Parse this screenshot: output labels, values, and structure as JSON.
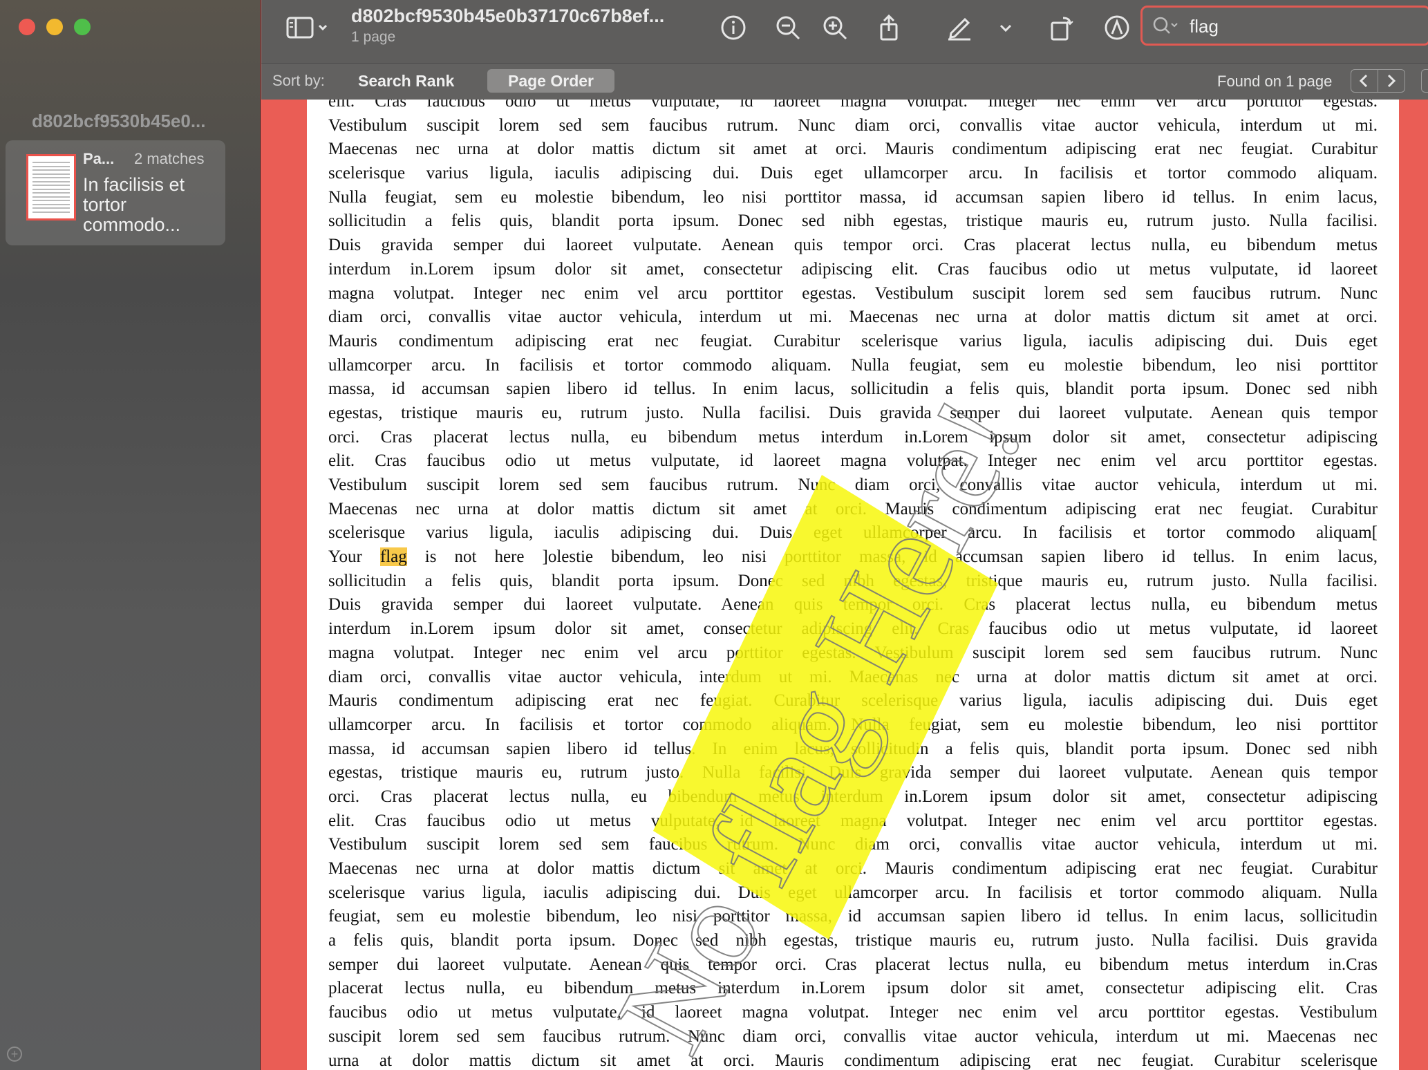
{
  "sidebar": {
    "title": "d802bcf9530b45e0...",
    "result": {
      "page_label": "Pa...",
      "matches": "2 matches",
      "snippet": "In facilisis et tortor commodo..."
    }
  },
  "toolbar": {
    "doc_title": "d802bcf9530b45e0b37170c67b8ef...",
    "doc_subtitle": "1 page",
    "search_value": "flag"
  },
  "sortbar": {
    "label": "Sort by:",
    "rank": "Search Rank",
    "order": "Page Order",
    "found": "Found on 1 page"
  },
  "document": {
    "lines": [
      "elit.  Cras faucibus odio ut metus vulputate, id laoreet magna volutpat.  Integer nec enim vel arcu porttitor egestas.",
      "Vestibulum suscipit lorem sed sem faucibus rutrum.  Nunc diam orci, convallis vitae auctor vehicula, interdum ut mi.",
      "Maecenas nec urna at dolor mattis dictum sit amet at orci.  Mauris condimentum adipiscing erat nec feugiat.  Curabitur",
      "scelerisque varius ligula, iaculis adipiscing dui.  Duis eget ullamcorper arcu.  In facilisis et tortor commodo aliquam.",
      "Nulla feugiat, sem eu molestie bibendum, leo nisi porttitor massa, id accumsan sapien libero id tellus.  In enim lacus,",
      "sollicitudin a felis quis, blandit porta ipsum.  Donec sed nibh egestas, tristique mauris eu, rutrum justo.  Nulla facilisi.",
      "Duis gravida semper dui laoreet vulputate.  Aenean quis tempor orci.  Cras placerat lectus nulla, eu bibendum metus",
      "interdum in.Lorem ipsum dolor sit amet, consectetur adipiscing elit.  Cras faucibus odio ut metus vulputate, id laoreet",
      "magna volutpat.  Integer nec enim vel arcu porttitor egestas.  Vestibulum suscipit lorem sed sem faucibus rutrum.  Nunc",
      "diam orci, convallis vitae auctor vehicula, interdum ut mi.  Maecenas nec urna at dolor mattis dictum sit amet at orci.",
      "Mauris condimentum adipiscing erat nec feugiat.  Curabitur scelerisque varius ligula, iaculis adipiscing dui.  Duis eget",
      "ullamcorper arcu.  In facilisis et tortor commodo aliquam.  Nulla feugiat, sem eu molestie bibendum, leo nisi porttitor",
      "massa, id accumsan sapien libero id tellus.  In enim lacus, sollicitudin a felis quis, blandit porta ipsum.  Donec sed nibh",
      "egestas, tristique mauris eu, rutrum justo.  Nulla facilisi.  Duis gravida semper dui laoreet vulputate.  Aenean quis tempor",
      "orci.  Cras placerat lectus nulla, eu bibendum metus interdum in.Lorem ipsum dolor sit amet, consectetur adipiscing",
      "elit.  Cras faucibus odio ut metus vulputate, id laoreet magna volutpat.  Integer nec enim vel arcu porttitor egestas.",
      "Vestibulum suscipit lorem sed sem faucibus rutrum.  Nunc diam orci, convallis vitae auctor vehicula, interdum ut mi.",
      "Maecenas nec urna at dolor mattis dictum sit amet at orci.  Mauris condimentum adipiscing erat nec feugiat.  Curabitur",
      "scelerisque varius ligula, iaculis adipiscing dui.  Duis eget ullamcorper arcu.  In facilisis et tortor commodo aliquam[",
      "Your |flag| is not here ]olestie bibendum, leo nisi porttitor massa, id accumsan sapien libero id tellus.  In enim lacus,",
      "sollicitudin a felis quis, blandit porta ipsum.  Donec sed nibh egestas, tristique mauris eu, rutrum justo.  Nulla facilisi.",
      "Duis gravida semper dui laoreet vulputate.  Aenean quis tempor orci.  Cras placerat lectus nulla, eu bibendum metus",
      "interdum in.Lorem ipsum dolor sit amet, consectetur adipiscing elit.  Cras faucibus odio ut metus vulputate, id laoreet",
      "magna volutpat.  Integer nec enim vel arcu porttitor egestas.  Vestibulum suscipit lorem sed sem faucibus rutrum.  Nunc",
      "diam orci, convallis vitae auctor vehicula, interdum ut mi.  Maecenas nec urna at dolor mattis dictum sit amet at orci.",
      "Mauris condimentum adipiscing erat nec feugiat.  Curabitur scelerisque varius ligula, iaculis adipiscing dui.  Duis eget",
      "ullamcorper arcu.  In facilisis et tortor commodo aliquam.  Nulla feugiat, sem eu molestie bibendum, leo nisi porttitor",
      "massa, id accumsan sapien libero id tellus.  In enim lacus, sollicitudin a felis quis, blandit porta ipsum.  Donec sed nibh",
      "egestas, tristique mauris eu, rutrum justo.  Nulla facilisi.  Duis gravida semper dui laoreet vulputate.  Aenean quis tempor",
      "orci.  Cras placerat lectus nulla, eu bibendum metus interdum in.Lorem ipsum dolor sit amet, consectetur adipiscing",
      "elit.  Cras faucibus odio ut metus vulputate, id laoreet magna volutpat.  Integer nec enim vel arcu porttitor egestas.",
      "Vestibulum suscipit lorem sed sem faucibus rutrum.  Nunc diam orci, convallis vitae auctor vehicula, interdum ut mi.",
      "Maecenas nec urna at dolor mattis dictum sit amet at orci.  Mauris condimentum adipiscing erat nec feugiat.  Curabitur",
      "scelerisque varius ligula, iaculis adipiscing dui.  Duis eget ullamcorper arcu.  In facilisis et tortor commodo aliquam.  Nulla",
      "feugiat, sem eu molestie bibendum, leo nisi porttitor massa, id accumsan sapien libero id tellus.  In enim lacus, sollicitudin",
      "a felis quis, blandit porta ipsum.  Donec sed nibh egestas, tristique mauris eu, rutrum justo.  Nulla facilisi.  Duis gravida",
      "semper dui laoreet vulputate.  Aenean quis tempor orci.  Cras placerat lectus nulla, eu bibendum metus interdum in.Cras",
      "placerat lectus nulla, eu bibendum metus interdum in.Lorem ipsum dolor sit amet, consectetur adipiscing elit.  Cras",
      "faucibus odio ut metus vulputate, id laoreet magna volutpat.  Integer nec enim vel arcu porttitor egestas.  Vestibulum",
      "suscipit lorem sed sem faucibus rutrum.  Nunc diam orci, convallis vitae auctor vehicula, interdum ut mi.  Maecenas nec",
      "urna at dolor mattis dictum sit amet at orci.  Mauris condimentum adipiscing erat nec feugiat.  Curabitur scelerisque"
    ],
    "watermark": "No flag Here!"
  },
  "colors": {
    "accent": "#ea5d55",
    "highlight": "#f8c94a",
    "watermark_box": "#f7f70a"
  }
}
